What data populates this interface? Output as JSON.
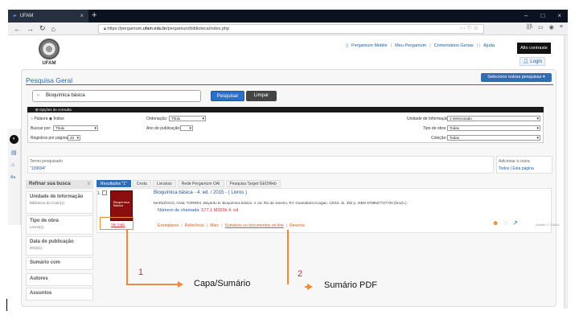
{
  "browser": {
    "tab_title": "UFAM",
    "tab_close": "×",
    "new_tab": "+",
    "window_controls": [
      "–",
      "□",
      "×"
    ],
    "url_prefix": "https://pergamum.",
    "url_domain": "ufam.edu.br",
    "url_suffix": "/pergamum/biblioteca/index.php",
    "url_right_icons": "··· ♡ ☆",
    "toolbar_icons": [
      "|||\\",
      "▭",
      "◉",
      "≡"
    ]
  },
  "header": {
    "logo_text": "UFAM",
    "links": [
      "Pergamum Mobile",
      "Meu Pergamum",
      "Comentários Gerais",
      "Ajuda"
    ],
    "contrast_button": "Alto contraste",
    "login": "Login"
  },
  "search": {
    "title": "Pesquisa Geral",
    "select_bases": "Selecione outras pesquisas",
    "query": "Bioquímica básica",
    "search_button": "Pesquisar",
    "clear_button": "Limpar",
    "options_header": "Opções de consulta",
    "radio_1": "Palavra",
    "radio_2": "Índice",
    "sort_label": "Ordenação:",
    "sort_value": "Título",
    "unit_label": "Unidade de Informação:",
    "unit_value": "1 selecionado",
    "search_by_label": "Buscar por:",
    "search_by_value": "Título",
    "year_label": "Ano de publicação:",
    "work_type_label": "Tipo de obra:",
    "work_type_value": "Todas",
    "per_page_label": "Registros por página:",
    "per_page_value": "20",
    "collection_label": "Coleção:",
    "collection_value": "Todas"
  },
  "terms": {
    "label": "Termo pesquisado",
    "value": "\"139694\"",
    "basket_label": "Adicionar à cesta:",
    "basket_all": "Todos",
    "basket_page": "Esta página"
  },
  "refine": {
    "header": "Refinar sua busca",
    "facets": [
      {
        "title": "Unidade de Informação",
        "sub": "Biblioteca do Coari(1)"
      },
      {
        "title": "Tipo de obra",
        "sub": "Livros(1)"
      },
      {
        "title": "Data de publicação",
        "sub": "2015(1)"
      },
      {
        "title": "Sumário com",
        "sub": ""
      },
      {
        "title": "Autores",
        "sub": ""
      },
      {
        "title": "Assuntos",
        "sub": ""
      }
    ]
  },
  "results": {
    "tabs": [
      "Resultados \"1\"",
      "Cesta",
      "Livrarias",
      "Rede Pergamum OAI",
      "Pesquisa Target GEDWeb"
    ],
    "index": "1.",
    "cover_text": "Bioquímica Básica",
    "more": "Ver mais",
    "title": "Bioquímica básica - 4. ed. / 2015 - ( Livros )",
    "description": "MARZZOCO, Anita; TORRES, Bayardo B. Bioquímica básica. 4. ed. Rio de Janeiro, RJ: Guanabara Koogan, c2015. xii, 392 p. ISBN 9788527727730 (broch.).",
    "call_label": "Número de chamada:",
    "call_value": "577.1 M393b 4. ed.",
    "actions": [
      "Exemplares",
      "Referência",
      "Marc",
      "Sumários ou documentos on-line",
      "Reserva"
    ],
    "rating_label": "Avaliar 1 / DASA"
  },
  "annotations": {
    "num_1": "1",
    "num_2": "2",
    "label_1": "Capa/Sumário",
    "label_2": "Sumário PDF"
  }
}
